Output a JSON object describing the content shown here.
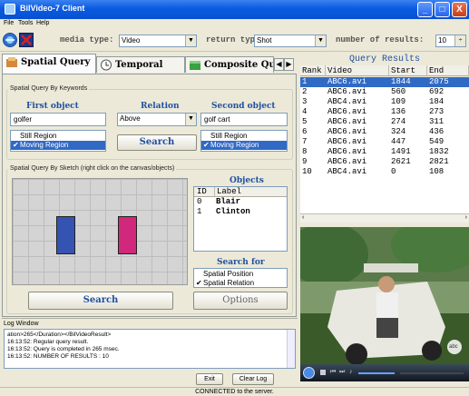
{
  "window": {
    "title": "BilVideo-7 Client",
    "minimize": "_",
    "maximize": "□",
    "close": "X"
  },
  "menu": {
    "file": "File",
    "tools": "Tools",
    "help": "Help"
  },
  "toolbar": {
    "media_type_label": "media type:",
    "media_type_value": "Video",
    "return_type_label": "return type:",
    "return_type_value": "Shot",
    "num_results_label": "number of results:",
    "num_results_value": "10"
  },
  "tabs": [
    {
      "label": "Spatial Query"
    },
    {
      "label": "Temporal Query"
    },
    {
      "label": "Composite Quer"
    }
  ],
  "keywords_group": {
    "title": "Spatial Query By Keywords",
    "first_object_header": "First object",
    "relation_header": "Relation",
    "second_object_header": "Second object",
    "first_object_value": "golfer",
    "relation_value": "Above",
    "second_object_value": "golf cart",
    "first_regions": [
      "Still Region",
      "Moving Region"
    ],
    "second_regions": [
      "Still Region",
      "Moving Region"
    ],
    "search_button": "Search"
  },
  "sketch_group": {
    "title": "Spatial Query By Sketch (right click on the canvas/objects)",
    "objects_title": "Objects",
    "col_id": "ID",
    "col_label": "Label",
    "objects": [
      {
        "id": "0",
        "label": "Blair",
        "color": "#3553b0"
      },
      {
        "id": "1",
        "label": "Clinton",
        "color": "#d0287a"
      }
    ],
    "search_for_title": "Search for",
    "search_for_items": [
      "Spatial Position",
      "Spatial Relation"
    ],
    "search_button": "Search",
    "options_button": "Options"
  },
  "results": {
    "title": "Query Results",
    "columns": [
      "Rank",
      "Video",
      "Start",
      "End"
    ],
    "rows": [
      [
        "1",
        "ABC6.avi",
        "1844",
        "2075"
      ],
      [
        "2",
        "ABC6.avi",
        "560",
        "692"
      ],
      [
        "3",
        "ABC4.avi",
        "109",
        "184"
      ],
      [
        "4",
        "ABC6.avi",
        "136",
        "273"
      ],
      [
        "5",
        "ABC6.avi",
        "274",
        "311"
      ],
      [
        "6",
        "ABC6.avi",
        "324",
        "436"
      ],
      [
        "7",
        "ABC6.avi",
        "447",
        "549"
      ],
      [
        "8",
        "ABC6.avi",
        "1491",
        "1832"
      ],
      [
        "9",
        "ABC6.avi",
        "2621",
        "2821"
      ],
      [
        "10",
        "ABC4.avi",
        "0",
        "108"
      ]
    ]
  },
  "video": {
    "watermark": "abc"
  },
  "log": {
    "title": "Log Window",
    "lines": [
      "ation>265</Duration></BilVideoResult>",
      "16:13:52: Regular query result.",
      "16:13:52: Query is completed in 265 msec.",
      "16:13:52: NUMBER OF RESULTS : 10"
    ],
    "exit_button": "Exit",
    "clear_button": "Clear Log"
  },
  "status": "CONNECTED to the server."
}
